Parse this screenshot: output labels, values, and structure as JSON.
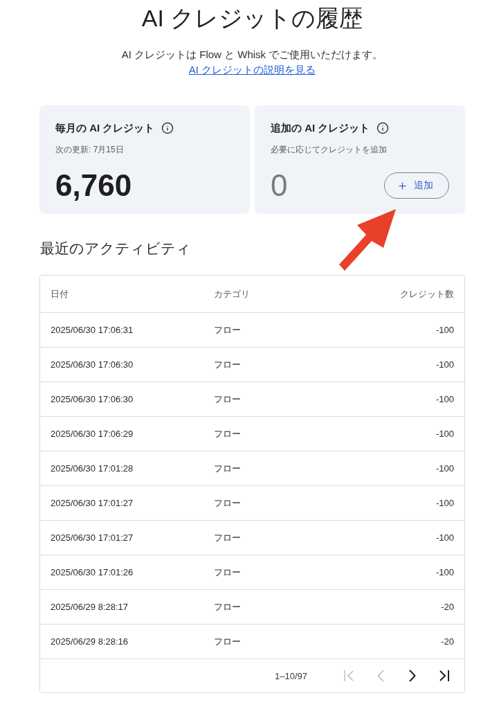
{
  "header": {
    "title": "AI クレジットの履歴",
    "description": "AI クレジットは Flow と Whisk でご使用いただけます。",
    "link": "AI クレジットの説明を見る"
  },
  "cards": [
    {
      "title": "毎月の AI クレジット",
      "subtitle": "次の更新: 7月15日",
      "amount": "6,760",
      "muted": false
    },
    {
      "title": "追加の AI クレジット",
      "subtitle": "必要に応じてクレジットを追加",
      "amount": "0",
      "muted": true,
      "button": "追加"
    }
  ],
  "activity": {
    "heading": "最近のアクティビティ",
    "table": {
      "columns": [
        "日付",
        "カテゴリ",
        "クレジット数"
      ],
      "rows": [
        [
          "2025/06/30 17:06:31",
          "フロー",
          "-100"
        ],
        [
          "2025/06/30 17:06:30",
          "フロー",
          "-100"
        ],
        [
          "2025/06/30 17:06:30",
          "フロー",
          "-100"
        ],
        [
          "2025/06/30 17:06:29",
          "フロー",
          "-100"
        ],
        [
          "2025/06/30 17:01:28",
          "フロー",
          "-100"
        ],
        [
          "2025/06/30 17:01:27",
          "フロー",
          "-100"
        ],
        [
          "2025/06/30 17:01:27",
          "フロー",
          "-100"
        ],
        [
          "2025/06/30 17:01:26",
          "フロー",
          "-100"
        ],
        [
          "2025/06/29 8:28:17",
          "フロー",
          "-20"
        ],
        [
          "2025/06/29 8:28:16",
          "フロー",
          "-20"
        ]
      ]
    },
    "pagination": {
      "range": "1–10/97",
      "buttons": [
        {
          "kind": "first",
          "disabled": true
        },
        {
          "kind": "prev",
          "disabled": true
        },
        {
          "kind": "next",
          "disabled": false
        },
        {
          "kind": "last",
          "disabled": false
        }
      ]
    }
  }
}
